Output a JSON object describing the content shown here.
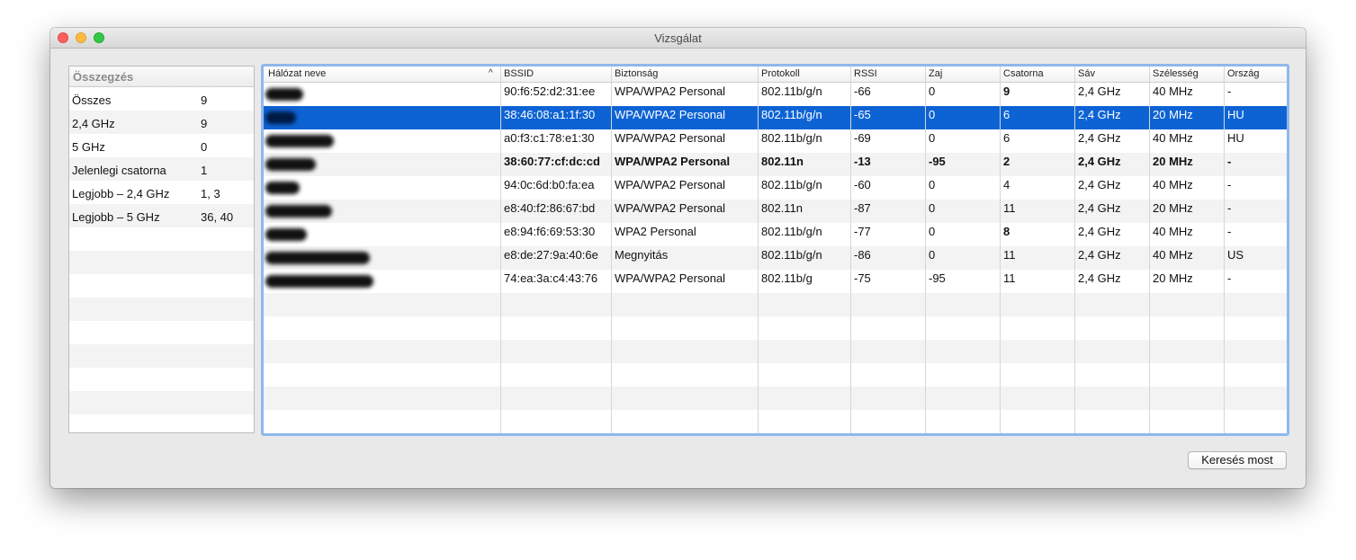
{
  "window": {
    "title": "Vizsgálat"
  },
  "summary": {
    "header": "Összegzés",
    "rows": [
      {
        "label": "Összes",
        "value": "9"
      },
      {
        "label": "2,4 GHz",
        "value": "9"
      },
      {
        "label": "5 GHz",
        "value": "0"
      },
      {
        "label": "Jelenlegi csatorna",
        "value": "1"
      },
      {
        "label": "Legjobb – 2,4 GHz",
        "value": "1, 3"
      },
      {
        "label": "Legjobb – 5 GHz",
        "value": "36, 40"
      }
    ]
  },
  "table": {
    "sort_indicator": "^",
    "columns": [
      "Hálózat neve",
      "BSSID",
      "Biztonság",
      "Protokoll",
      "RSSI",
      "Zaj",
      "Csatorna",
      "Sáv",
      "Szélesség",
      "Ország"
    ],
    "rows": [
      {
        "bssid": "90:f6:52:d2:31:ee",
        "security": "WPA/WPA2 Personal",
        "protocol": "802.11b/g/n",
        "rssi": "-66",
        "noise": "0",
        "channel": "9",
        "band": "2,4 GHz",
        "width": "40 MHz",
        "country": "-"
      },
      {
        "bssid": "38:46:08:a1:1f:30",
        "security": "WPA/WPA2 Personal",
        "protocol": "802.11b/g/n",
        "rssi": "-65",
        "noise": "0",
        "channel": "6",
        "band": "2,4 GHz",
        "width": "20 MHz",
        "country": "HU"
      },
      {
        "bssid": "a0:f3:c1:78:e1:30",
        "security": "WPA/WPA2 Personal",
        "protocol": "802.11b/g/n",
        "rssi": "-69",
        "noise": "0",
        "channel": "6",
        "band": "2,4 GHz",
        "width": "40 MHz",
        "country": "HU"
      },
      {
        "bssid": "38:60:77:cf:dc:cd",
        "security": "WPA/WPA2 Personal",
        "protocol": "802.11n",
        "rssi": "-13",
        "noise": "-95",
        "channel": "2",
        "band": "2,4 GHz",
        "width": "20 MHz",
        "country": "-"
      },
      {
        "bssid": "94:0c:6d:b0:fa:ea",
        "security": "WPA/WPA2 Personal",
        "protocol": "802.11b/g/n",
        "rssi": "-60",
        "noise": "0",
        "channel": "4",
        "band": "2,4 GHz",
        "width": "40 MHz",
        "country": "-"
      },
      {
        "bssid": "e8:40:f2:86:67:bd",
        "security": "WPA/WPA2 Personal",
        "protocol": "802.11n",
        "rssi": "-87",
        "noise": "0",
        "channel": "11",
        "band": "2,4 GHz",
        "width": "20 MHz",
        "country": "-"
      },
      {
        "bssid": "e8:94:f6:69:53:30",
        "security": "WPA2 Personal",
        "protocol": "802.11b/g/n",
        "rssi": "-77",
        "noise": "0",
        "channel": "8",
        "band": "2,4 GHz",
        "width": "40 MHz",
        "country": "-"
      },
      {
        "bssid": "e8:de:27:9a:40:6e",
        "security": "Megnyitás",
        "protocol": "802.11b/g/n",
        "rssi": "-86",
        "noise": "0",
        "channel": "11",
        "band": "2,4 GHz",
        "width": "40 MHz",
        "country": "US"
      },
      {
        "bssid": "74:ea:3a:c4:43:76",
        "security": "WPA/WPA2 Personal",
        "protocol": "802.11b/g",
        "rssi": "-75",
        "noise": "-95",
        "channel": "11",
        "band": "2,4 GHz",
        "width": "20 MHz",
        "country": "-"
      }
    ]
  },
  "actions": {
    "scan_now": "Keresés most"
  },
  "colors": {
    "selection": "#0d63d4",
    "focus_ring": "#8fb8ec"
  }
}
